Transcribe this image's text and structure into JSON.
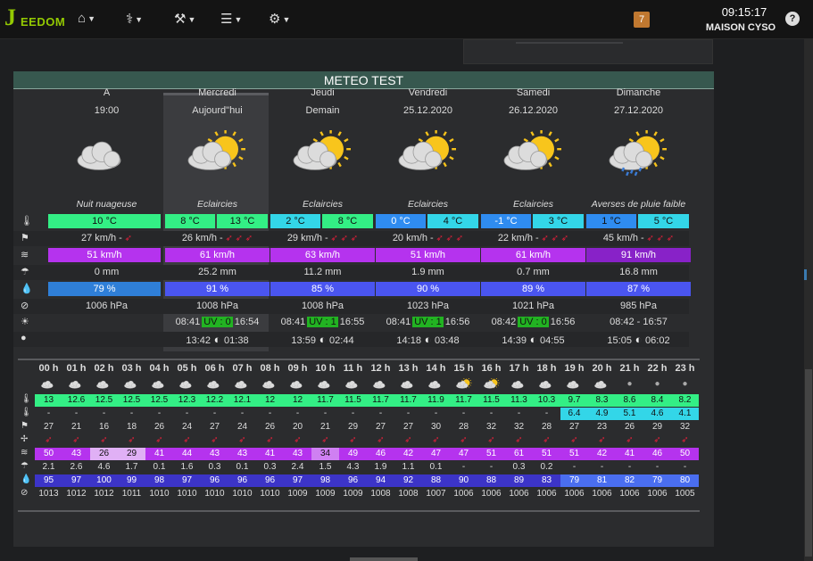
{
  "header": {
    "logo_text": "EEDOM",
    "notification_count": "7",
    "clock": "09:15:17",
    "house_name": "MAISON CYSO",
    "help_label": "?",
    "menus": [
      {
        "name": "home-icon",
        "glyph": "⌂"
      },
      {
        "name": "stethoscope-icon",
        "glyph": "⚕"
      },
      {
        "name": "wrench-icon",
        "glyph": "⚒"
      },
      {
        "name": "list-icon",
        "glyph": "☰"
      },
      {
        "name": "gear-icon",
        "glyph": "⚙"
      }
    ]
  },
  "widget": {
    "title": "METEO TEST",
    "columns": [
      {
        "title": "A",
        "sub": "19:00",
        "icon": "cloud-night-icon",
        "cond": "Nuit nuageuse",
        "t1": "10 °C",
        "t2": "",
        "wind": "27 km/h -",
        "arrows": 1,
        "gust": "51 km/h",
        "rain": "0 mm",
        "hum": "79 %",
        "press": "1006 hPa",
        "sunrise": "",
        "uv": "",
        "sunset": "",
        "moonrise": "",
        "moonset": ""
      },
      {
        "title": "Mercredi",
        "sub": "Aujourd\"hui",
        "icon": "sun-cloud-icon",
        "cond": "Eclaircies",
        "t1": "8 °C",
        "t2": "13 °C",
        "wind": "26 km/h -",
        "arrows": 3,
        "gust": "61 km/h",
        "rain": "25.2 mm",
        "hum": "91 %",
        "press": "1008 hPa",
        "sunrise": "08:41",
        "uv": "UV : 0",
        "sunset": "16:54",
        "moonrise": "13:42",
        "moonset": "01:38"
      },
      {
        "title": "Jeudi",
        "sub": "Demain",
        "icon": "sun-cloud-icon",
        "cond": "Eclaircies",
        "t1": "2 °C",
        "t2": "8 °C",
        "wind": "29 km/h -",
        "arrows": 3,
        "gust": "63 km/h",
        "rain": "11.2 mm",
        "hum": "85 %",
        "press": "1008 hPa",
        "sunrise": "08:41",
        "uv": "UV : 1",
        "sunset": "16:55",
        "moonrise": "13:59",
        "moonset": "02:44"
      },
      {
        "title": "Vendredi",
        "sub": "25.12.2020",
        "icon": "sun-cloud-icon",
        "cond": "Eclaircies",
        "t1": "0 °C",
        "t2": "4 °C",
        "wind": "20 km/h -",
        "arrows": 3,
        "gust": "51 km/h",
        "rain": "1.9 mm",
        "hum": "90 %",
        "press": "1023 hPa",
        "sunrise": "08:41",
        "uv": "UV : 1",
        "sunset": "16:56",
        "moonrise": "14:18",
        "moonset": "03:48"
      },
      {
        "title": "Samedi",
        "sub": "26.12.2020",
        "icon": "sun-cloud-icon",
        "cond": "Eclaircies",
        "t1": "-1 °C",
        "t2": "3 °C",
        "wind": "22 km/h -",
        "arrows": 3,
        "gust": "61 km/h",
        "rain": "0.7 mm",
        "hum": "89 %",
        "press": "1021 hPa",
        "sunrise": "08:42",
        "uv": "UV : 0",
        "sunset": "16:56",
        "moonrise": "14:39",
        "moonset": "04:55"
      },
      {
        "title": "Dimanche",
        "sub": "27.12.2020",
        "icon": "sun-rain-icon",
        "cond": "Averses de pluie faible",
        "t1": "1 °C",
        "t2": "5 °C",
        "wind": "45 km/h -",
        "arrows": 3,
        "gust": "91 km/h",
        "rain": "16.8 mm",
        "hum": "87 %",
        "press": "985 hPa",
        "sunrise": "08:42 - 16:57",
        "uv": "",
        "sunset": "",
        "moonrise": "15:05",
        "moonset": "06:02"
      }
    ],
    "hours": [
      "00 h",
      "01 h",
      "02 h",
      "03 h",
      "04 h",
      "05 h",
      "06 h",
      "07 h",
      "08 h",
      "09 h",
      "10 h",
      "11 h",
      "12 h",
      "13 h",
      "14 h",
      "15 h",
      "16 h",
      "17 h",
      "18 h",
      "19 h",
      "20 h",
      "21 h",
      "22 h",
      "23 h"
    ],
    "hourly": {
      "icons": [
        "c",
        "c",
        "c",
        "c",
        "c",
        "c",
        "c",
        "c",
        "c",
        "c",
        "c",
        "c",
        "c",
        "c",
        "c",
        "s",
        "s",
        "c",
        "c",
        "c",
        "c",
        "m",
        "m",
        "m"
      ],
      "temp": [
        "13",
        "12.6",
        "12.5",
        "12.5",
        "12.5",
        "12.3",
        "12.2",
        "12.1",
        "12",
        "12",
        "11.7",
        "11.5",
        "11.7",
        "11.7",
        "11.9",
        "11.7",
        "11.5",
        "11.3",
        "10.3",
        "9.7",
        "8.3",
        "8.6",
        "8.4",
        "8.2"
      ],
      "temp2": [
        "-",
        "-",
        "-",
        "-",
        "-",
        "-",
        "-",
        "-",
        "-",
        "-",
        "-",
        "-",
        "-",
        "-",
        "-",
        "-",
        "-",
        "-",
        "-",
        "6.4",
        "4.9",
        "5.1",
        "4.6",
        "4.1"
      ],
      "wind": [
        "27",
        "21",
        "16",
        "18",
        "26",
        "24",
        "27",
        "24",
        "26",
        "20",
        "21",
        "29",
        "27",
        "27",
        "30",
        "28",
        "32",
        "32",
        "28",
        "27",
        "23",
        "26",
        "29",
        "32"
      ],
      "gust": [
        "50",
        "43",
        "26",
        "29",
        "41",
        "44",
        "43",
        "43",
        "41",
        "43",
        "34",
        "49",
        "46",
        "42",
        "47",
        "47",
        "51",
        "61",
        "51",
        "51",
        "42",
        "41",
        "46",
        "50"
      ],
      "rain": [
        "2.1",
        "2.6",
        "4.6",
        "1.7",
        "0.1",
        "1.6",
        "0.3",
        "0.1",
        "0.3",
        "2.4",
        "1.5",
        "4.3",
        "1.9",
        "1.1",
        "0.1",
        "-",
        "-",
        "0.3",
        "0.2",
        "-",
        "-",
        "-",
        "-",
        "-"
      ],
      "hum": [
        "95",
        "97",
        "100",
        "99",
        "98",
        "97",
        "96",
        "96",
        "96",
        "97",
        "98",
        "96",
        "94",
        "92",
        "88",
        "90",
        "88",
        "89",
        "83",
        "79",
        "81",
        "82",
        "79",
        "80"
      ],
      "press": [
        "1013",
        "1012",
        "1012",
        "1011",
        "1010",
        "1010",
        "1010",
        "1010",
        "1010",
        "1009",
        "1009",
        "1009",
        "1008",
        "1008",
        "1007",
        "1006",
        "1006",
        "1006",
        "1006",
        "1006",
        "1006",
        "1006",
        "1006",
        "1005"
      ]
    },
    "colors": {
      "temp_green": "#33ef85",
      "temp_cyan": "#33d6e8",
      "temp_blue": "#2f8cf0",
      "gust_purple": "#b533ee",
      "gust_dark": "#8822c8",
      "hum_blue": "#4a55f0"
    }
  }
}
